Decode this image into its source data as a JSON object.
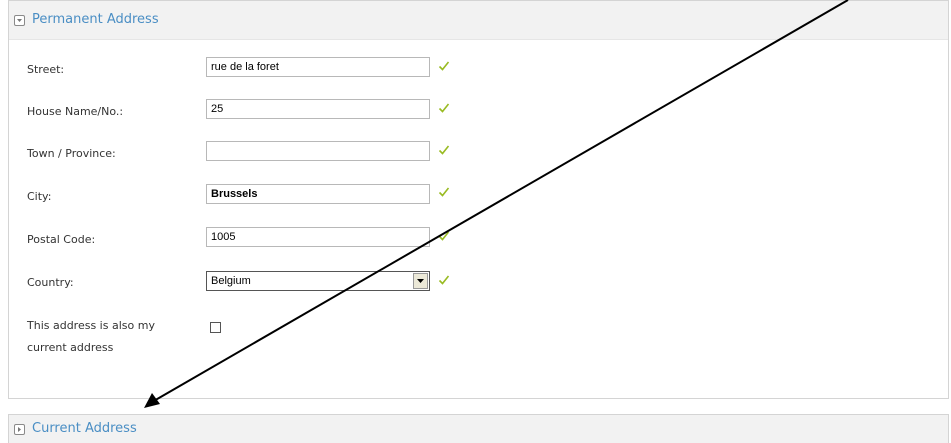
{
  "permanent_section": {
    "title": "Permanent Address",
    "fields": [
      {
        "label": "Street:",
        "value": "rue de la foret",
        "valid": true
      },
      {
        "label": "House Name/No.:",
        "value": "25",
        "valid": true
      },
      {
        "label": "Town / Province:",
        "value": "",
        "valid": true
      },
      {
        "label": "City:",
        "value": "Brussels",
        "valid": true
      },
      {
        "label": "Postal Code:",
        "value": "1005",
        "valid": true
      }
    ],
    "country": {
      "label": "Country:",
      "selected": "Belgium",
      "valid": true
    },
    "same_address": {
      "label_line1": "This address is also my",
      "label_line2": "current address",
      "checked": false
    }
  },
  "current_section": {
    "title": "Current Address",
    "collapsed": true
  },
  "colors": {
    "accent_title": "#4a8ec4",
    "check_green": "#99bb22",
    "header_bg": "#f2f2f2",
    "annotation_arrow": "#000000"
  },
  "icons": {
    "expanded_toggle": "chevron-down-icon",
    "collapsed_toggle": "chevron-right-icon",
    "validation": "checkmark-icon"
  }
}
